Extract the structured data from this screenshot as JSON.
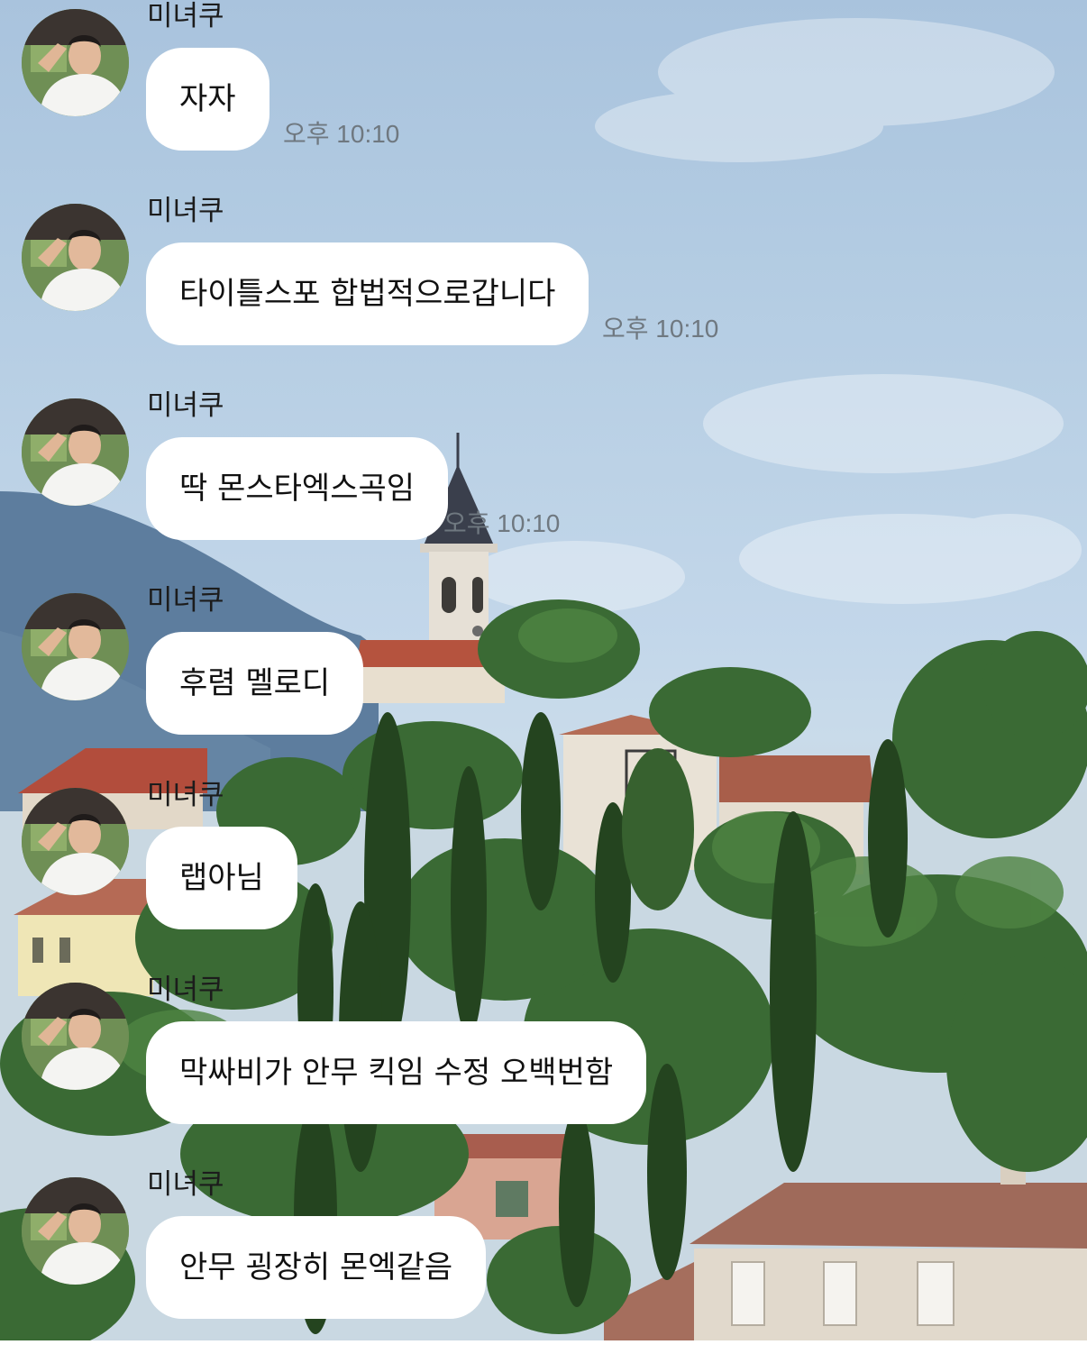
{
  "chat": {
    "messages": [
      {
        "sender": "미녀쿠",
        "text": "자자",
        "time": "오후 10:10"
      },
      {
        "sender": "미녀쿠",
        "text": "타이틀스포 합법적으로갑니다",
        "time": "오후 10:10"
      },
      {
        "sender": "미녀쿠",
        "text": "딱 몬스타엑스곡임",
        "time": "오후 10:10"
      },
      {
        "sender": "미녀쿠",
        "text": "후렴 멜로디",
        "time": ""
      },
      {
        "sender": "미녀쿠",
        "text": "랩아님",
        "time": ""
      },
      {
        "sender": "미녀쿠",
        "text": "막싸비가 안무 킥임  수정 오백번함",
        "time": ""
      },
      {
        "sender": "미녀쿠",
        "text": "안무 굉장히 몬엑같음",
        "time": ""
      }
    ]
  },
  "background": {
    "description_icon": "landscape-photo",
    "sky_color": "#b7cde3",
    "foliage_color": "#2f5a2a"
  }
}
